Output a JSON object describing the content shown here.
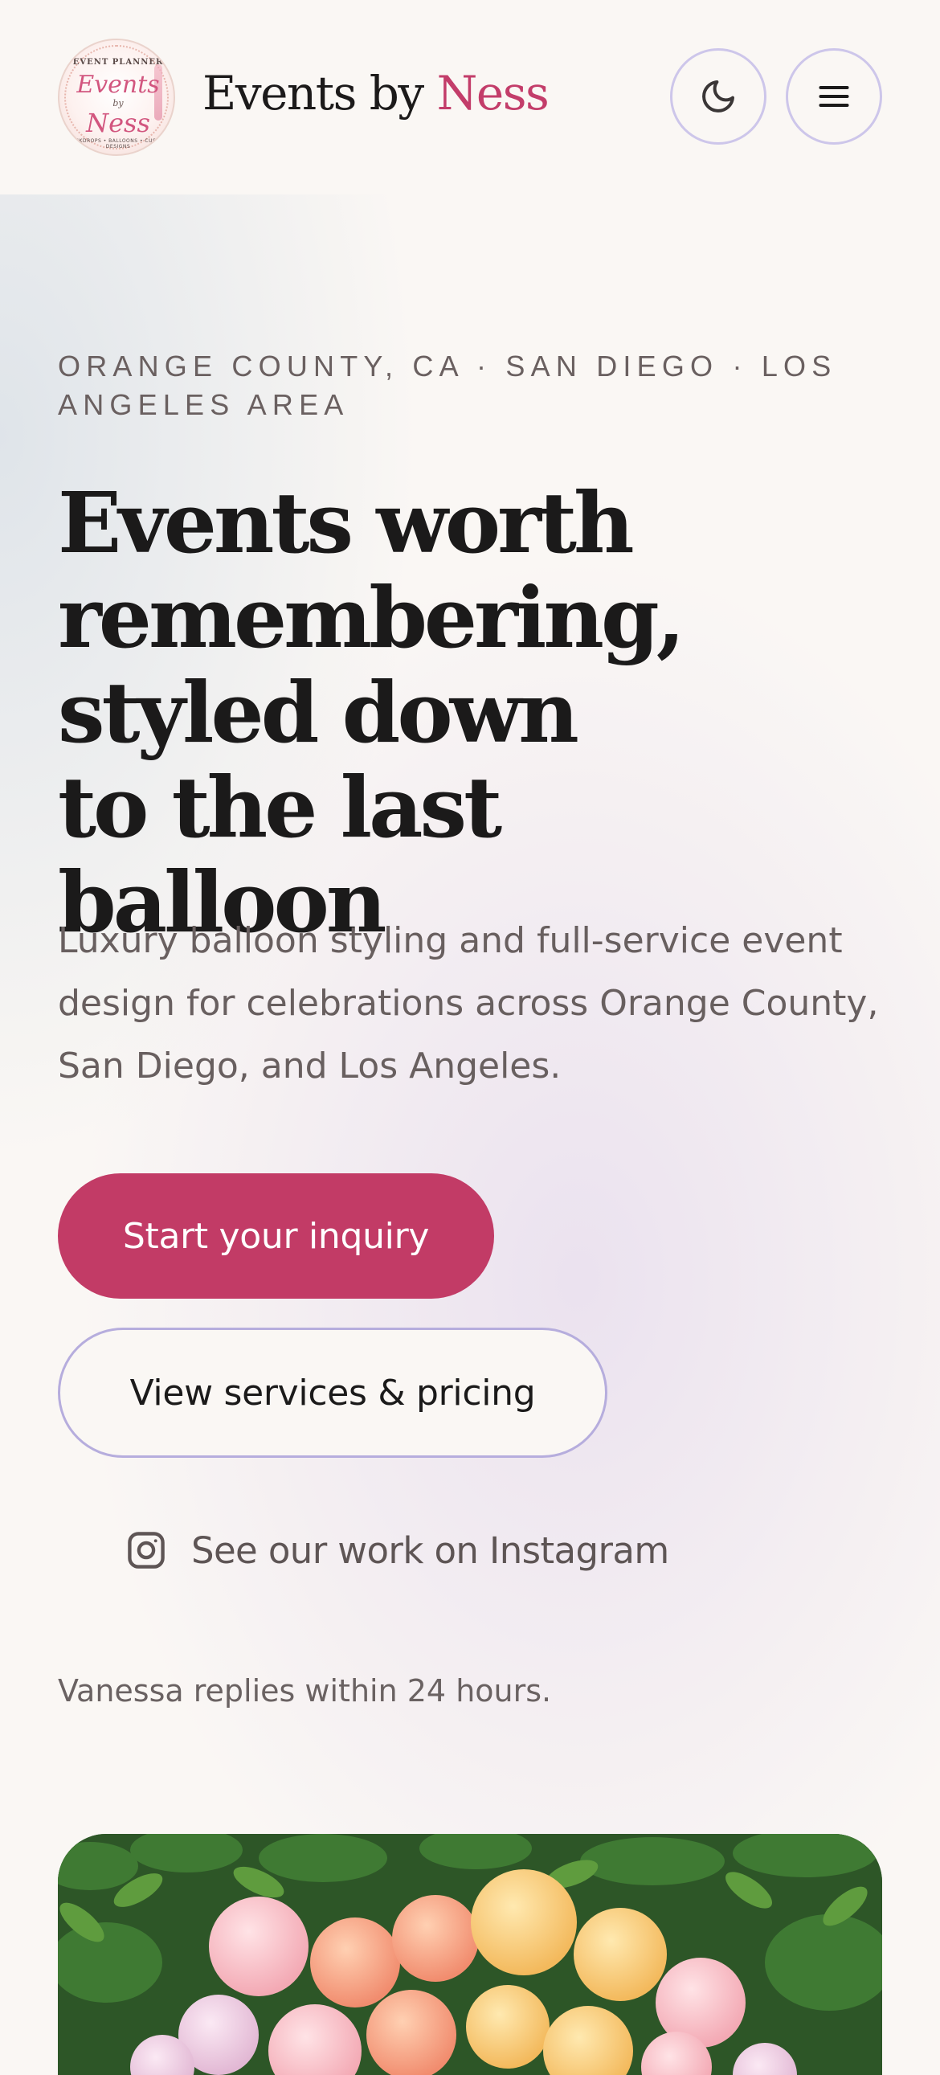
{
  "header": {
    "logo": {
      "top_text": "EVENT PLANNER",
      "script_line1": "Events",
      "script_line2": "by",
      "script_line3": "Ness",
      "bottom_text": "BACKDROPS • BALLOONS • CUSTOM DESIGNS"
    },
    "brand_prefix": "Events by ",
    "brand_accent": "Ness",
    "theme_toggle_icon": "moon-icon",
    "menu_icon": "hamburger-menu-icon"
  },
  "hero": {
    "eyebrow": "ORANGE COUNTY, CA · SAN DIEGO · LOS ANGELES AREA",
    "headline": "Events worth remembering, styled down to the last balloon",
    "lead": "Luxury balloon styling and full-service event design for celebrations across Orange County, San Diego, and Los Angeles.",
    "primary_cta": "Start your inquiry",
    "secondary_cta": "View services & pricing",
    "instagram_link": "See our work on Instagram",
    "instagram_icon": "instagram-icon",
    "reply_note": "Vanessa replies within 24 hours.",
    "image": "balloon-garland-photo"
  },
  "colors": {
    "accent": "#c23b66",
    "background": "#faf7f4",
    "outline": "#b6addd",
    "text": "#1b1a1a",
    "muted_text": "#685f5f"
  }
}
